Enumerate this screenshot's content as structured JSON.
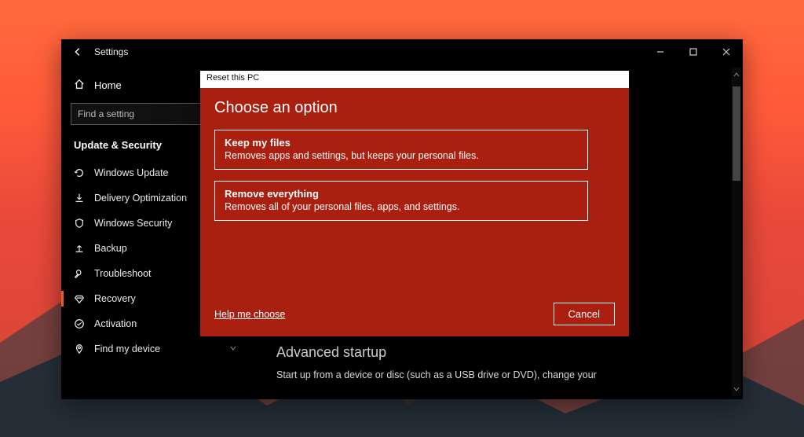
{
  "window": {
    "title": "Settings"
  },
  "sidebar": {
    "home": "Home",
    "search_placeholder": "Find a setting",
    "section": "Update & Security",
    "items": [
      {
        "label": "Windows Update",
        "icon": "refresh"
      },
      {
        "label": "Delivery Optimization",
        "icon": "download"
      },
      {
        "label": "Windows Security",
        "icon": "shield"
      },
      {
        "label": "Backup",
        "icon": "upload"
      },
      {
        "label": "Troubleshoot",
        "icon": "wrench"
      },
      {
        "label": "Recovery",
        "icon": "recovery",
        "active": true
      },
      {
        "label": "Activation",
        "icon": "check"
      },
      {
        "label": "Find my device",
        "icon": "location",
        "chevron": true
      }
    ]
  },
  "content": {
    "advanced_heading": "Advanced startup",
    "advanced_text": "Start up from a device or disc (such as a USB drive or DVD), change your"
  },
  "dialog": {
    "title": "Reset this PC",
    "heading": "Choose an option",
    "options": [
      {
        "title": "Keep my files",
        "desc": "Removes apps and settings, but keeps your personal files."
      },
      {
        "title": "Remove everything",
        "desc": "Removes all of your personal files, apps, and settings."
      }
    ],
    "help": "Help me choose",
    "cancel": "Cancel"
  }
}
